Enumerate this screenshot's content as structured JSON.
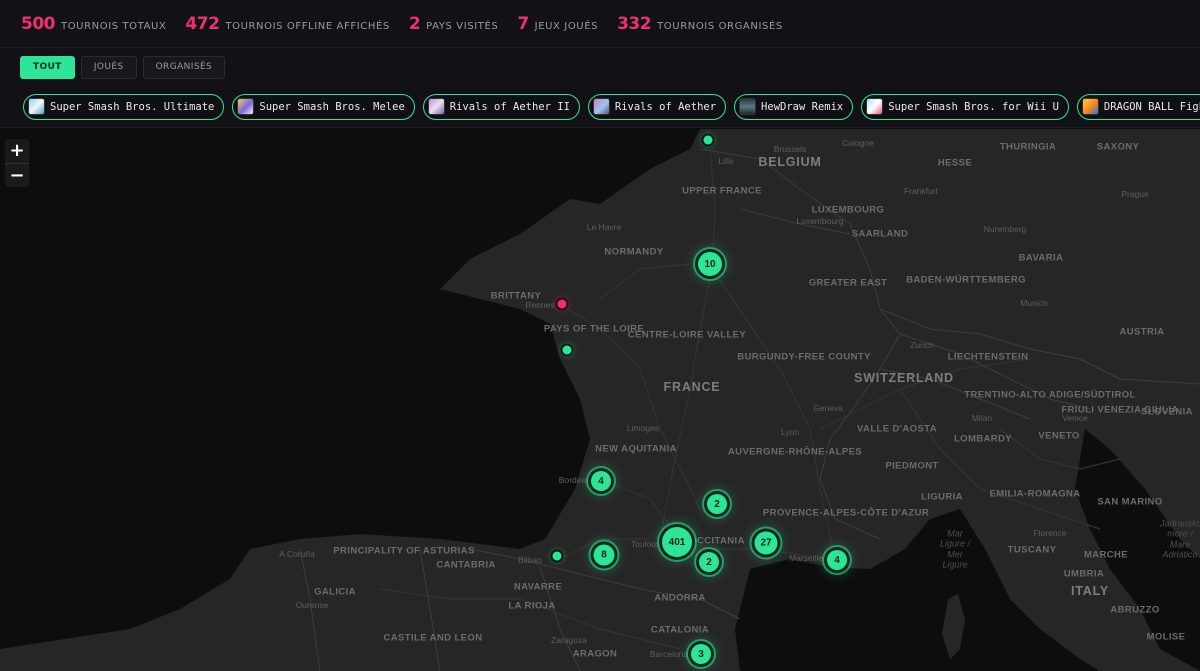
{
  "stats": [
    {
      "value": "500",
      "label": "TOURNOIS TOTAUX"
    },
    {
      "value": "472",
      "label": "TOURNOIS OFFLINE AFFICHÉS"
    },
    {
      "value": "2",
      "label": "PAYS VISITÉS"
    },
    {
      "value": "7",
      "label": "JEUX JOUÉS"
    },
    {
      "value": "332",
      "label": "TOURNOIS ORGANISÉS"
    }
  ],
  "tabs": [
    {
      "label": "TOUT",
      "active": true
    },
    {
      "label": "JOUÉS",
      "active": false
    },
    {
      "label": "ORGANISÉS",
      "active": false
    }
  ],
  "games": [
    {
      "label": "Super Smash Bros. Ultimate"
    },
    {
      "label": "Super Smash Bros. Melee"
    },
    {
      "label": "Rivals of Aether II"
    },
    {
      "label": "Rivals of Aether"
    },
    {
      "label": "HewDraw Remix"
    },
    {
      "label": "Super Smash Bros. for Wii U"
    },
    {
      "label": "DRAGON BALL FighterZ"
    }
  ],
  "zoom": {
    "in": "+",
    "out": "−"
  },
  "colors": {
    "accent": "#2de596",
    "stat": "#f0306e",
    "dot_pink": "#f0306e",
    "land": "#262626",
    "sea": "#0d0d0d"
  },
  "map_labels": {
    "countries": [
      "BELGIUM",
      "FRANCE",
      "SWITZERLAND",
      "LUXEMBOURG",
      "ANDORRA",
      "LIECHTENSTEIN",
      "ITALY",
      "SLOVENIA"
    ],
    "regions": [
      "HESSE",
      "THURINGIA",
      "SAXONY",
      "UPPER FRANCE",
      "SAARLAND",
      "BAVARIA",
      "NORMANDY",
      "GREATER EAST",
      "BADEN-WÜRTTEMBERG",
      "BRITTANY",
      "PAYS OF THE LOIRE",
      "CENTRE-LOIRE VALLEY",
      "BURGUNDY-FREE COUNTY",
      "AUSTRIA",
      "TRENTINO-ALTO ADIGE/SÜDTIROL",
      "FRIULI VENEZIA GIULIA",
      "VALLE D'AOSTA",
      "LOMBARDY",
      "VENETO",
      "NEW AQUITANIA",
      "AUVERGNE-RHÔNE-ALPES",
      "PIEDMONT",
      "LIGURIA",
      "EMILIA-ROMAGNA",
      "PROVENCE-ALPES-CÔTE D'AZUR",
      "TUSCANY",
      "SAN MARINO",
      "MARCHE",
      "UMBRIA",
      "ABRUZZO",
      "MOLISE",
      "PRINCIPALITY OF ASTURIAS",
      "CANTABRIA",
      "GALICIA",
      "NAVARRE",
      "LA RIOJA",
      "CASTILE AND LEON",
      "CATALONIA",
      "ARAGON",
      "OCCITANIA"
    ],
    "cities": [
      "Lille",
      "Brussels",
      "Cologne",
      "Frankfurt",
      "Prague",
      "Luxembourg",
      "Nuremberg",
      "Le Havre",
      "Rennes",
      "Munich",
      "Zurich",
      "Geneva",
      "Lyon",
      "Limoges",
      "Bordeaux",
      "Toulouse",
      "Marseille",
      "Bilbao",
      "A Coruña",
      "Ourense",
      "Zaragoza",
      "Barcelona",
      "Milan",
      "Venice",
      "Florence"
    ],
    "seas": [
      "Mar Ligure / Mer Ligure",
      "Jadransko more / Mare Adriatico"
    ]
  },
  "clusters": [
    {
      "count": "10"
    },
    {
      "count": "4"
    },
    {
      "count": "2"
    },
    {
      "count": "401"
    },
    {
      "count": "27"
    },
    {
      "count": "2"
    },
    {
      "count": "8"
    },
    {
      "count": "4"
    },
    {
      "count": "3"
    }
  ]
}
